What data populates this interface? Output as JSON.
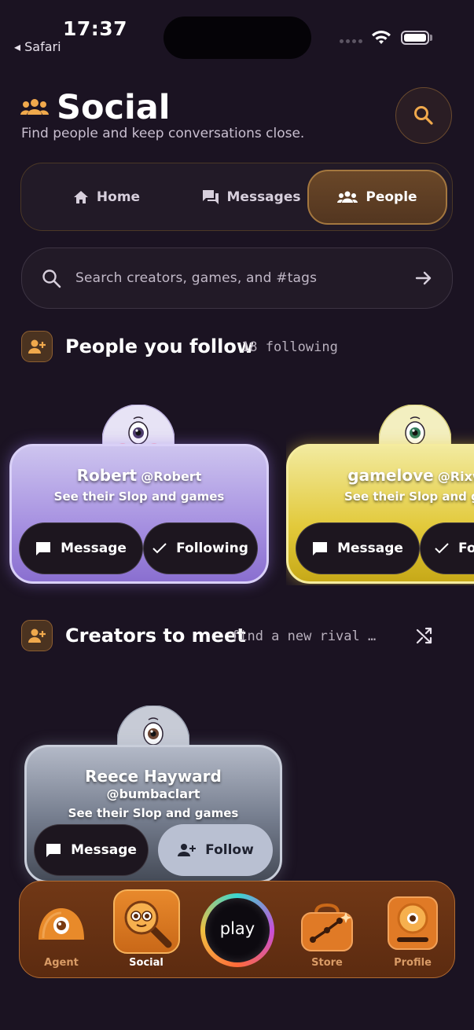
{
  "status_bar": {
    "time": "17:37",
    "back_app": "◂ Safari"
  },
  "header": {
    "title": "Social",
    "subtitle": "Find people and keep conversations close."
  },
  "tabs": [
    {
      "label": "Home",
      "icon": "home-icon",
      "active": false
    },
    {
      "label": "Messages",
      "icon": "chat-icon",
      "active": false
    },
    {
      "label": "People",
      "icon": "people-icon",
      "active": true
    }
  ],
  "search": {
    "placeholder": "Search creators, games, and #tags"
  },
  "following_section": {
    "title": "People you follow",
    "subtitle": "18 following"
  },
  "following_cards": [
    {
      "name": "Robert",
      "handle": "@Robert",
      "tagline": "See their Slop and games",
      "message_label": "Message",
      "follow_label": "Following",
      "theme": "#a187d8"
    },
    {
      "name": "gamelove",
      "handle": "@Rixw",
      "tagline": "See their Slop and ga",
      "message_label": "Message",
      "follow_label": "Fol",
      "theme": "#e3ce3d"
    }
  ],
  "creators_section": {
    "title": "Creators to meet",
    "subtitle": "find a new rival …"
  },
  "creator_cards": [
    {
      "name": "Reece Hayward",
      "handle": "@bumbaclart",
      "tagline": "See their Slop and games",
      "message_label": "Message",
      "follow_label": "Follow",
      "theme": "#8d96a8"
    }
  ],
  "bottom_nav": {
    "items": [
      {
        "label": "Agent",
        "icon": "agent-blob-icon",
        "active": false
      },
      {
        "label": "Social",
        "icon": "magnifier-creature-icon",
        "active": true
      },
      {
        "label": "play",
        "icon": "play-orb-icon",
        "active": false
      },
      {
        "label": "Store",
        "icon": "store-bag-icon",
        "active": false
      },
      {
        "label": "Profile",
        "icon": "profile-card-icon",
        "active": false
      }
    ]
  },
  "colors": {
    "background": "#1b1322",
    "accent": "#e9a44e",
    "nav_bg": "#713816"
  }
}
